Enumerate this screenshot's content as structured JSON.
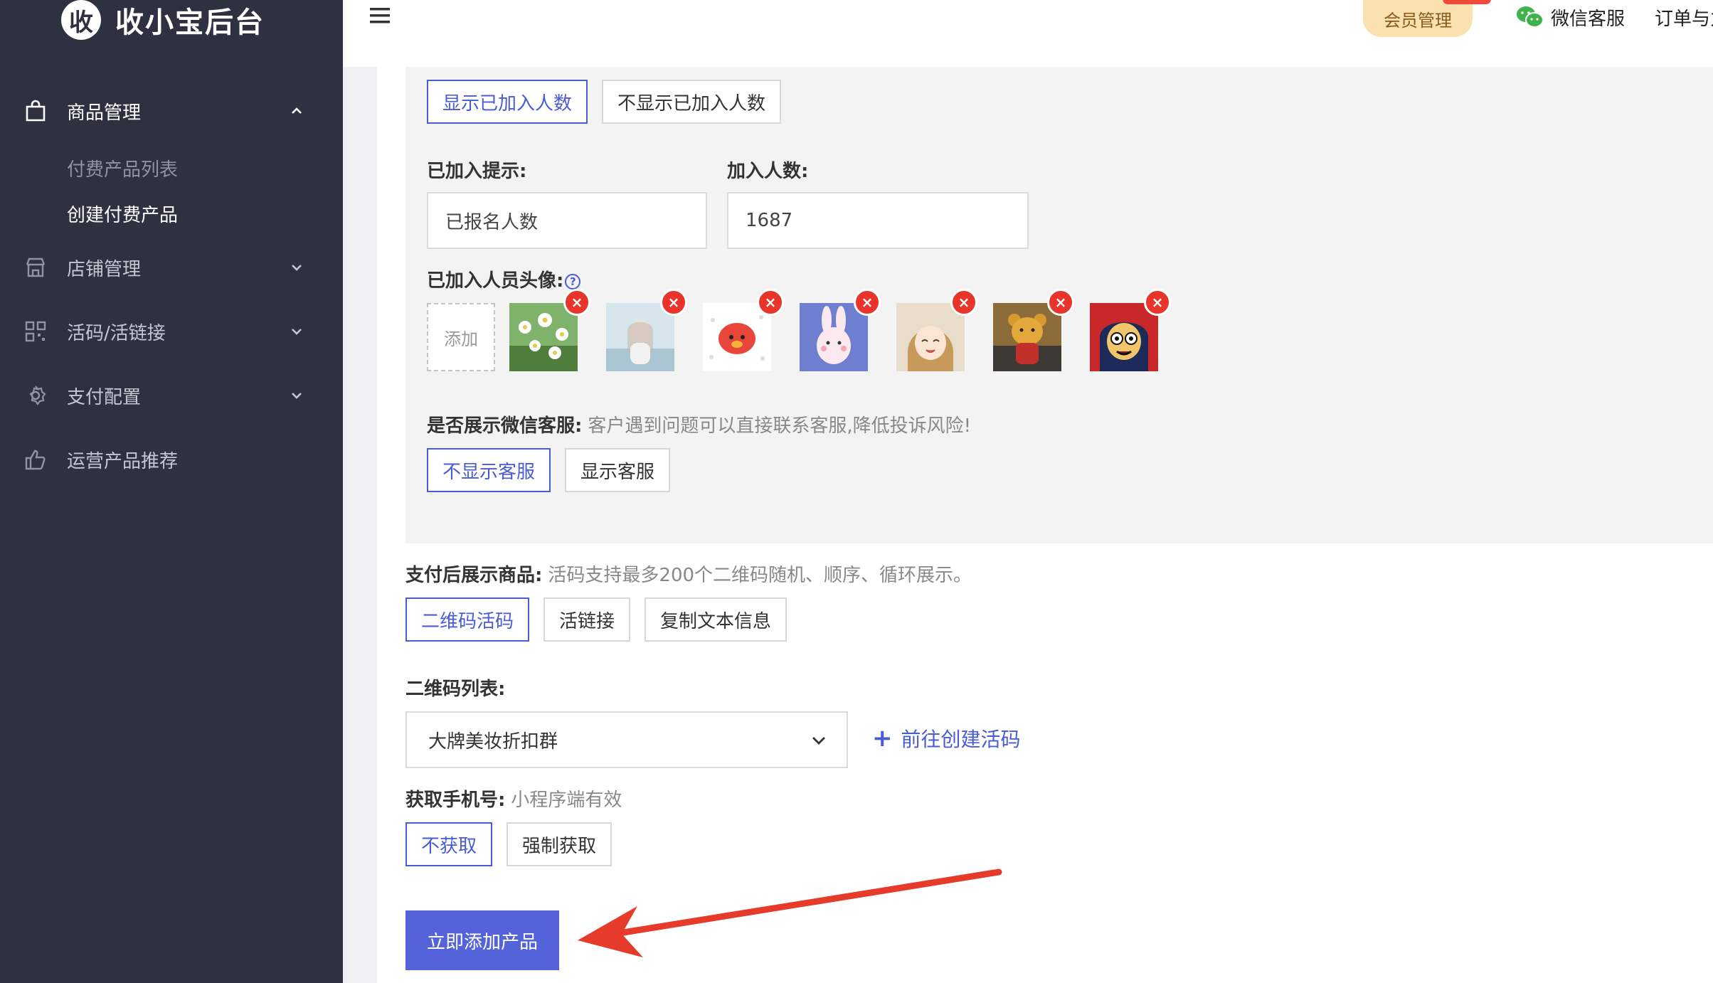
{
  "app": {
    "logo_char": "收",
    "title": "收小宝后台"
  },
  "sidebar": {
    "items": [
      {
        "label": "商品管理",
        "icon": "shopping-bag-icon",
        "expanded": true
      },
      {
        "label": "店铺管理",
        "icon": "store-icon"
      },
      {
        "label": "活码/活链接",
        "icon": "qr-code-icon"
      },
      {
        "label": "支付配置",
        "icon": "gear-icon"
      },
      {
        "label": "运营产品推荐",
        "icon": "thumbs-up-icon"
      }
    ],
    "sub_items": [
      {
        "label": "付费产品列表"
      },
      {
        "label": "创建付费产品",
        "current": true
      }
    ]
  },
  "header": {
    "member_label": "会员管理",
    "wechat_service_label": "微信客服",
    "orders_label": "订单与力"
  },
  "form": {
    "joined_count_toggle": {
      "options": [
        "显示已加入人数",
        "不显示已加入人数"
      ],
      "selected": "显示已加入人数"
    },
    "joined_hint_label": "已加入提示:",
    "joined_hint_value": "已报名人数",
    "joined_count_label": "加入人数:",
    "joined_count_value": "1687",
    "avatars_label": "已加入人员头像:",
    "help_glyph": "?",
    "add_label": "添加",
    "avatar_count": 7,
    "remove_glyph": "×",
    "show_wechat_service": {
      "label": "是否展示微信客服:",
      "hint": "客户遇到问题可以直接联系客服,降低投诉风险!",
      "options": [
        "不显示客服",
        "显示客服"
      ],
      "selected": "不显示客服"
    },
    "after_pay": {
      "label": "支付后展示商品:",
      "hint": "活码支持最多200个二维码随机、顺序、循环展示。",
      "options": [
        "二维码活码",
        "活链接",
        "复制文本信息"
      ],
      "selected": "二维码活码"
    },
    "qr_list": {
      "label": "二维码列表:",
      "selected_value": "大牌美妆折扣群",
      "create_link": "前往创建活码",
      "plus_glyph": "+"
    },
    "phone": {
      "label": "获取手机号:",
      "hint": "小程序端有效",
      "options": [
        "不获取",
        "强制获取"
      ],
      "selected": "不获取"
    },
    "submit_label": "立即添加产品"
  },
  "colors": {
    "sidebar_bg": "#2e3240",
    "accent": "#4a5bd6",
    "submit_bg": "#5563db",
    "remove_red": "#e8342a",
    "annotation_arrow": "#e63a2a"
  }
}
